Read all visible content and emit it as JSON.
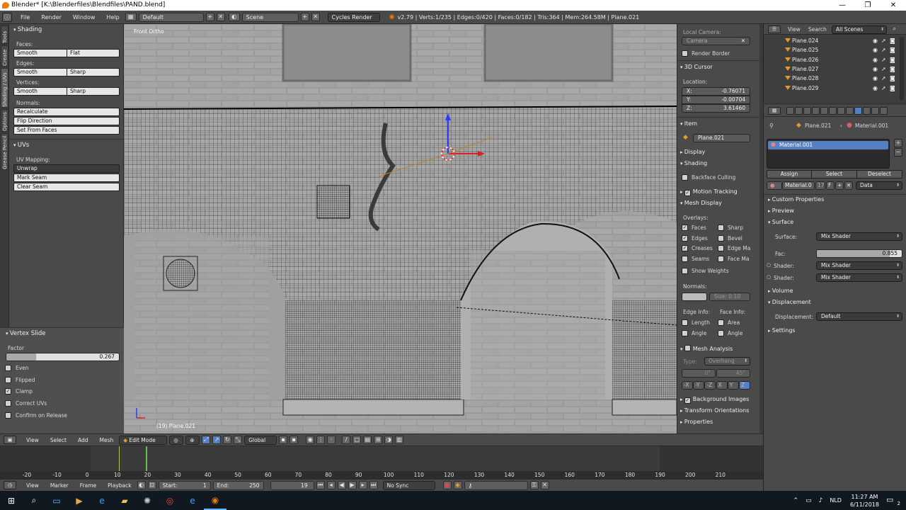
{
  "title": "Blender* [K:\\Blenderfiles\\Blendfiles\\PAND.blend]",
  "info_header": {
    "menus": [
      "File",
      "Render",
      "Window",
      "Help"
    ],
    "layout": "Default",
    "scene": "Scene",
    "engine": "Cycles Render",
    "stats": "v2.79 | Verts:1/235 | Edges:0/420 | Faces:0/182 | Tris:364 | Mem:264.58M | Plane.021"
  },
  "left_tabs": [
    "Tools",
    "Create",
    "Shading / UVs",
    "Options",
    "Grease Pencil"
  ],
  "tool_shelf": {
    "shading_title": "Shading",
    "faces_label": "Faces:",
    "edges_label": "Edges:",
    "vertices_label": "Vertices:",
    "smooth": "Smooth",
    "flat": "Flat",
    "sharp": "Sharp",
    "normals_label": "Normals:",
    "recalculate": "Recalculate",
    "flip_direction": "Flip Direction",
    "set_from_faces": "Set From Faces",
    "uvs_title": "UVs",
    "uv_mapping_label": "UV Mapping:",
    "unwrap": "Unwrap",
    "mark_seam": "Mark Seam",
    "clear_seam": "Clear Seam",
    "vertex_slide_title": "Vertex Slide",
    "factor_label": "Factor",
    "factor_value": "0.267",
    "factor_fraction": 0.267,
    "options": [
      {
        "label": "Even",
        "checked": false
      },
      {
        "label": "Flipped",
        "checked": false
      },
      {
        "label": "Clamp",
        "checked": true
      },
      {
        "label": "Correct UVs",
        "checked": false
      },
      {
        "label": "Confirm on Release",
        "checked": false
      }
    ]
  },
  "viewport": {
    "view_label": "Front Ortho",
    "object_label": "(19) Plane.021"
  },
  "n_panel": {
    "local_camera_label": "Local Camera:",
    "camera": "Camera",
    "render_border": "Render Border",
    "cursor_title": "3D Cursor",
    "location_label": "Location:",
    "x_label": "X:",
    "x_value": "-0.76071",
    "y_label": "Y:",
    "y_value": "-0.00704",
    "z_label": "Z:",
    "z_value": "3.61460",
    "item_title": "Item",
    "item_name": "Plane.021",
    "display_title": "Display",
    "shading_title": "Shading",
    "backface_culling": "Backface Culling",
    "motion_tracking": "Motion Tracking",
    "mesh_display_title": "Mesh Display",
    "overlays_label": "Overlays:",
    "overlays_left": [
      {
        "label": "Faces",
        "checked": true
      },
      {
        "label": "Edges",
        "checked": true
      },
      {
        "label": "Creases",
        "checked": true
      },
      {
        "label": "Seams",
        "checked": false
      }
    ],
    "overlays_right": [
      {
        "label": "Sharp",
        "checked": false
      },
      {
        "label": "Bevel",
        "checked": false
      },
      {
        "label": "Edge Ma",
        "checked": false
      },
      {
        "label": "Face Ma",
        "checked": false
      }
    ],
    "show_weights": "Show Weights",
    "normals_label": "Normals:",
    "size_label": "Size: 0.10",
    "edge_info_label": "Edge Info:",
    "face_info_label": "Face Info:",
    "length": "Length",
    "area": "Area",
    "angle1": "Angle",
    "angle2": "Angle",
    "mesh_analysis_title": "Mesh Analysis",
    "type_label": "Type:",
    "type_value": "Overhang",
    "angle_min": "0°",
    "angle_max": "45°",
    "axes": [
      "-X",
      "-Y",
      "-Z",
      "X",
      "Y",
      "Z"
    ],
    "background_images": "Background Images",
    "transform_orientations": "Transform Orientations",
    "properties": "Properties"
  },
  "outliner": {
    "view": "View",
    "search": "Search",
    "scenes": "All Scenes",
    "items": [
      "Plane.024",
      "Plane.025",
      "Plane.026",
      "Plane.027",
      "Plane.028",
      "Plane.029"
    ]
  },
  "properties": {
    "object": "Plane.021",
    "material": "Material.001",
    "slot": "Material.001",
    "assign": "Assign",
    "select": "Select",
    "deselect": "Deselect",
    "mat_field": "Material.0",
    "mat_users": "17",
    "mat_f": "F",
    "link": "Data",
    "custom_properties": "Custom Properties",
    "preview": "Preview",
    "surface_title": "Surface",
    "surface_label": "Surface:",
    "surface_value": "Mix Shader",
    "fac_label": "Fac:",
    "fac_value": "0.855",
    "fac_fraction": 0.855,
    "shader_label": "Shader:",
    "shader1": "Mix Shader",
    "shader2": "Mix Shader",
    "volume": "Volume",
    "displacement_title": "Displacement",
    "displacement_label": "Displacement:",
    "displacement_value": "Default",
    "settings": "Settings"
  },
  "view3d_header": {
    "menus": [
      "View",
      "Select",
      "Add",
      "Mesh"
    ],
    "mode": "Edit Mode",
    "orientation": "Global"
  },
  "timeline": {
    "ticks": [
      "-20",
      "-10",
      "0",
      "10",
      "20",
      "30",
      "40",
      "50",
      "60",
      "70",
      "80",
      "90",
      "100",
      "110",
      "120",
      "130",
      "140",
      "150",
      "160",
      "170",
      "180",
      "190",
      "200",
      "210"
    ],
    "menus": [
      "View",
      "Marker",
      "Frame",
      "Playback"
    ],
    "start_label": "Start:",
    "start": "1",
    "end_label": "End:",
    "end": "250",
    "current": "19",
    "sync": "No Sync"
  },
  "taskbar": {
    "lang": "NLD",
    "time": "11:27 AM",
    "date": "6/11/2018",
    "notif": "2"
  }
}
